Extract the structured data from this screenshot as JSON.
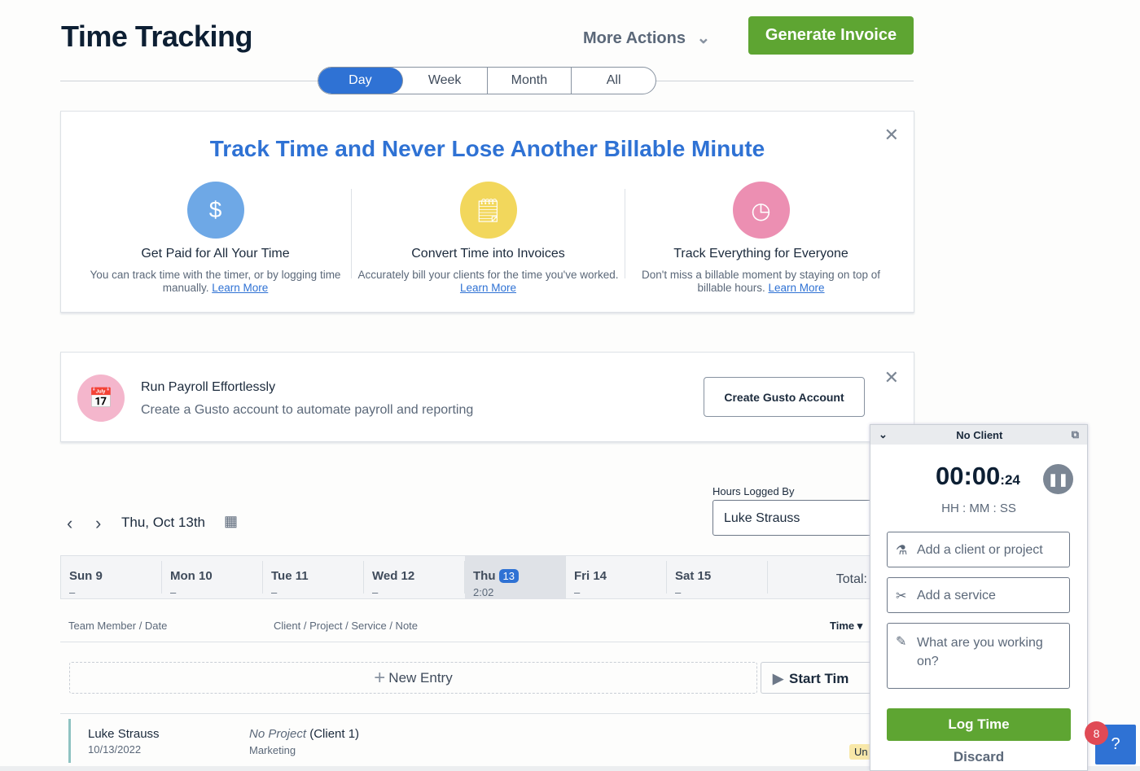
{
  "header": {
    "title": "Time Tracking",
    "more_actions": "More Actions",
    "generate_invoice": "Generate Invoice"
  },
  "range_tabs": [
    {
      "label": "Day",
      "active": true
    },
    {
      "label": "Week"
    },
    {
      "label": "Month"
    },
    {
      "label": "All"
    }
  ],
  "promo": {
    "title": "Track Time and Never Lose Another Billable Minute",
    "columns": [
      {
        "icon": "alarm-clock-dollar-icon",
        "heading": "Get Paid for All Your Time",
        "text": "You can track time with the timer, or by logging time manually.",
        "link": "Learn More"
      },
      {
        "icon": "invoice-clock-icon",
        "heading": "Convert Time into Invoices",
        "text": "Accurately bill your clients for the time you've worked.",
        "link": "Learn More"
      },
      {
        "icon": "team-clocks-icon",
        "heading": "Track Everything for Everyone",
        "text": "Don't miss a billable moment by staying on top of billable hours.",
        "link": "Learn More"
      }
    ]
  },
  "payroll": {
    "title": "Run Payroll Effortlessly",
    "text": "Create a Gusto account to automate payroll and reporting",
    "button": "Create Gusto Account"
  },
  "date_nav": {
    "date": "Thu, Oct 13th",
    "hours_logged_by_label": "Hours Logged By",
    "hours_logged_by": "Luke Strauss"
  },
  "week": [
    {
      "label": "Sun 9",
      "value": "–"
    },
    {
      "label": "Mon 10",
      "value": "–"
    },
    {
      "label": "Tue 11",
      "value": "–"
    },
    {
      "label": "Wed 12",
      "value": "–"
    },
    {
      "label": "Thu",
      "num": "13",
      "value": "2:02",
      "selected": true
    },
    {
      "label": "Fri 14",
      "value": "–"
    },
    {
      "label": "Sat 15",
      "value": "–"
    }
  ],
  "total_label": "Total:",
  "table": {
    "col_member": "Team Member / Date",
    "col_client": "Client / Project / Service / Note",
    "col_time": "Time ▾",
    "new_entry": "New Entry",
    "start_timer": "Start Tim",
    "rows": [
      {
        "name": "Luke Strauss",
        "date": "10/13/2022",
        "project": "No Project",
        "client": "(Client 1)",
        "service": "Marketing",
        "status": "Un"
      }
    ]
  },
  "timer": {
    "client": "No Client",
    "time_main": "00:00",
    "time_sec": ":24",
    "format": "HH : MM : SS",
    "client_placeholder": "Add a client or project",
    "service_placeholder": "Add a service",
    "note_placeholder": "What are you working on?",
    "log_time": "Log Time",
    "discard": "Discard"
  },
  "help": {
    "badge": "8"
  }
}
